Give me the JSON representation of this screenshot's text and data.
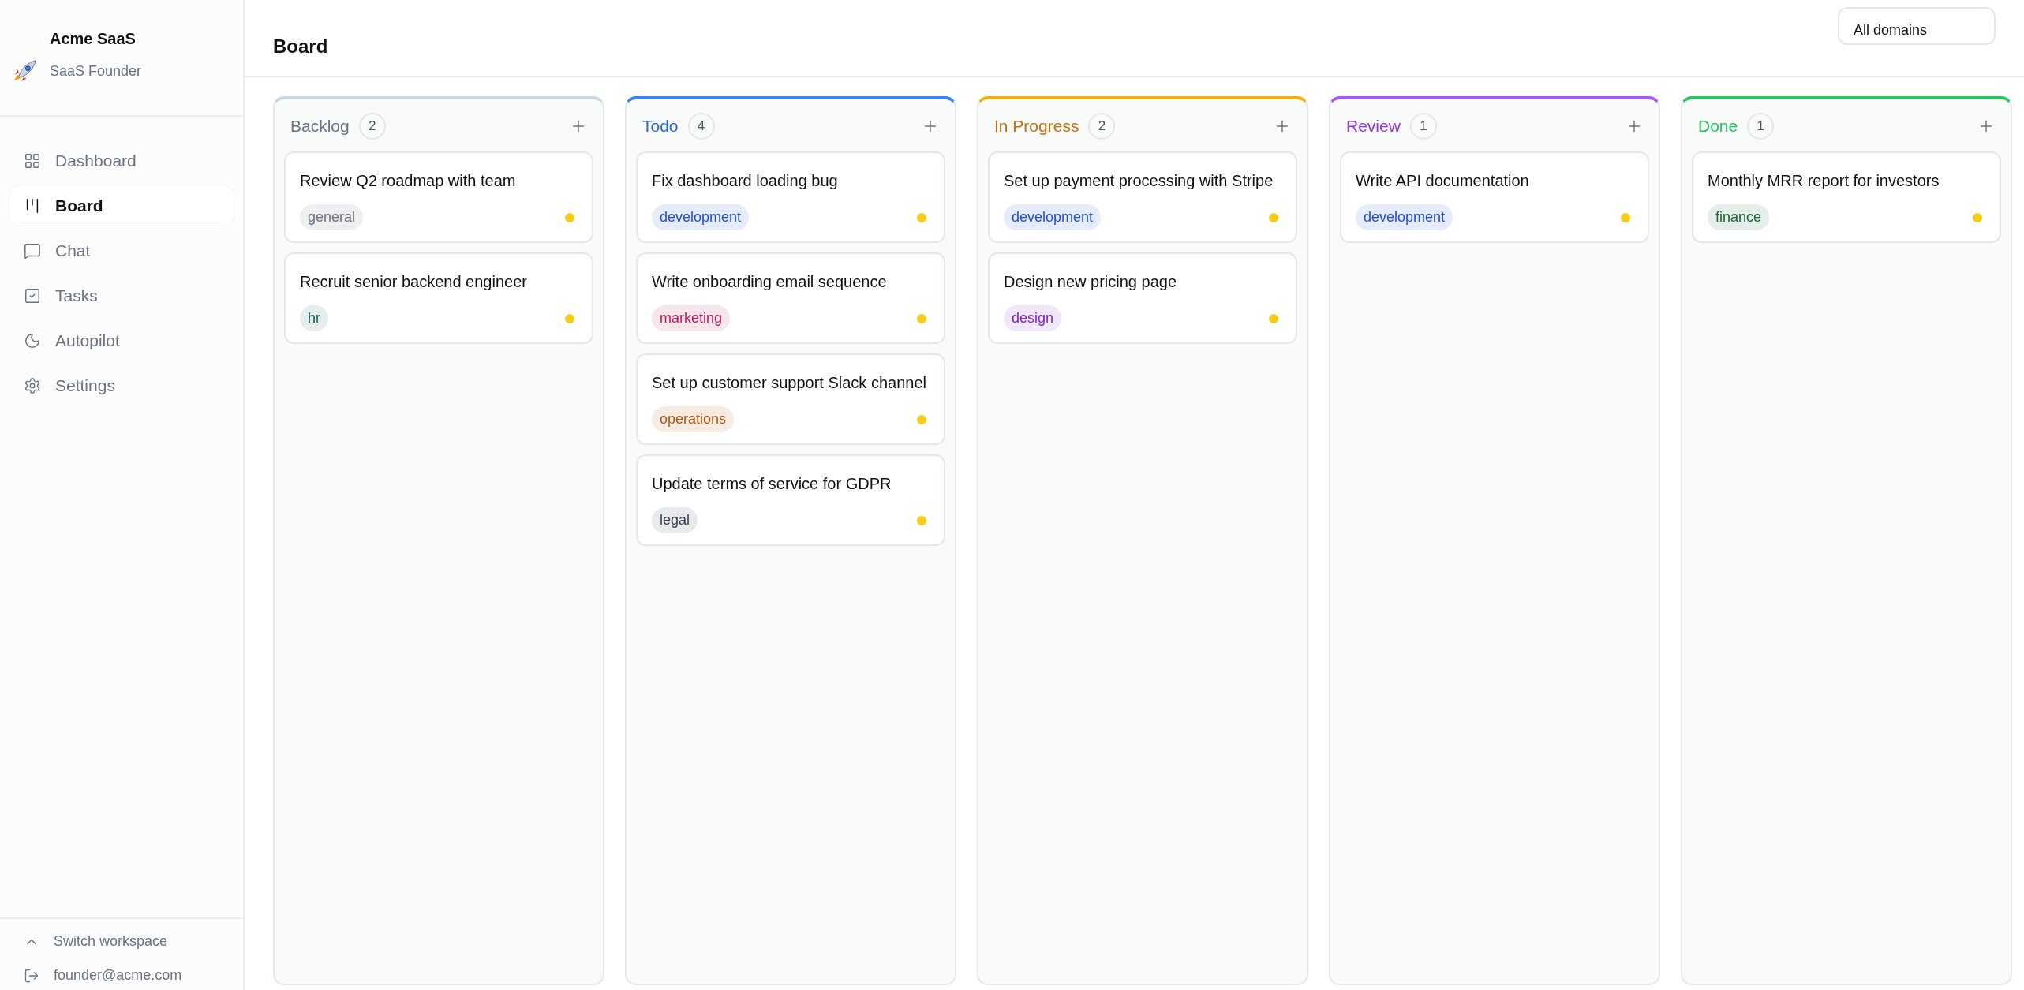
{
  "sidebar": {
    "workspace_name": "Acme SaaS",
    "workspace_role": "SaaS Founder",
    "items": [
      {
        "kind": "dashboard",
        "label": "Dashboard",
        "selected": false
      },
      {
        "kind": "board",
        "label": "Board",
        "selected": true
      },
      {
        "kind": "chat",
        "label": "Chat",
        "selected": false
      },
      {
        "kind": "tasks",
        "label": "Tasks",
        "selected": false
      },
      {
        "kind": "autopilot",
        "label": "Autopilot",
        "selected": false
      },
      {
        "kind": "settings",
        "label": "Settings",
        "selected": false
      }
    ],
    "footer": [
      {
        "kind": "switch",
        "label": "Switch workspace"
      },
      {
        "kind": "logout",
        "label": "founder@acme.com"
      }
    ]
  },
  "header": {
    "title": "Board",
    "domain_filter": "All domains"
  },
  "columns": [
    {
      "title": "Backlog",
      "count": "2",
      "color": "#cbd5e1",
      "cards": [
        {
          "title": "Review Q2 roadmap with team",
          "tag": "general",
          "color": "#6b7280"
        },
        {
          "title": "Recruit senior backend engineer",
          "tag": "hr",
          "color": "#115e59"
        }
      ]
    },
    {
      "title": "Todo",
      "count": "4",
      "color": "#3b82f6",
      "cards": [
        {
          "title": "Fix dashboard loading bug",
          "tag": "development",
          "color": "#1d4ed8"
        },
        {
          "title": "Write onboarding email sequence",
          "tag": "marketing",
          "color": "#be185d"
        },
        {
          "title": "Set up customer support Slack channel",
          "tag": "operations",
          "color": "#b45309"
        },
        {
          "title": "Update terms of service for GDPR",
          "tag": "legal",
          "color": "#374151"
        }
      ]
    },
    {
      "title": "In Progress",
      "count": "2",
      "color": "#eab308",
      "cards": [
        {
          "title": "Set up payment processing with Stripe",
          "tag": "development",
          "color": "#1d4ed8"
        },
        {
          "title": "Design new pricing page",
          "tag": "design",
          "color": "#7e22ce"
        }
      ]
    },
    {
      "title": "Review",
      "count": "1",
      "color": "#a855f7",
      "cards": [
        {
          "title": "Write API documentation",
          "tag": "development",
          "color": "#1d4ed8"
        }
      ]
    },
    {
      "title": "Done",
      "count": "1",
      "color": "#22c55e",
      "cards": [
        {
          "title": "Monthly MRR report for investors",
          "tag": "finance",
          "color": "#166534"
        }
      ]
    }
  ]
}
